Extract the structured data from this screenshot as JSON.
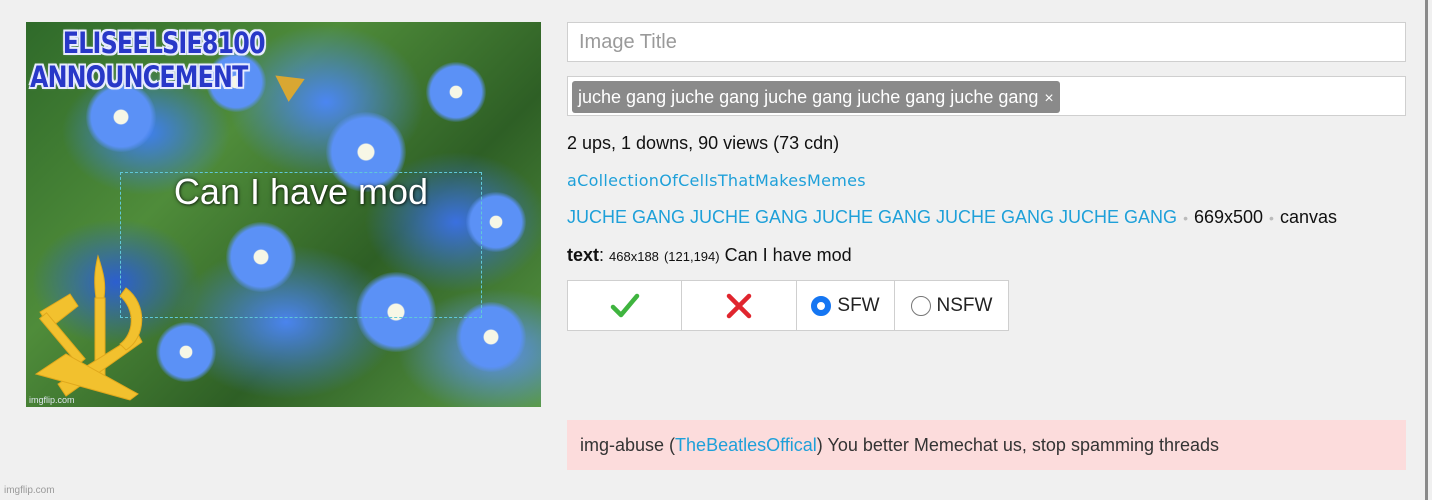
{
  "image": {
    "header_line1": "ELISEELSIE8100",
    "header_line2": "ANNOUNCEMENT",
    "overlay_text": "Can I have mod",
    "watermark": "imgflip.com"
  },
  "form": {
    "title_placeholder": "Image Title",
    "tags": [
      {
        "label": "juche gang juche gang juche gang juche gang juche gang",
        "remove_glyph": "×"
      }
    ]
  },
  "stats": "2 ups, 1 downs, 90 views (73 cdn)",
  "author": "aCollectionOfCellsThatMakesMemes",
  "meta": {
    "tag_link": "JUCHE GANG JUCHE GANG JUCHE GANG JUCHE GANG JUCHE GANG",
    "separator": "•",
    "dimensions": "669x500",
    "type": "canvas"
  },
  "text_box": {
    "label": "text",
    "dims": "468x188",
    "position": "(121,194)",
    "value": "Can I have mod"
  },
  "moderation": {
    "approve_icon": "checkmark-icon",
    "approve_color": "#3fb43f",
    "reject_icon": "x-icon",
    "reject_color": "#e0252e",
    "sfw_label": "SFW",
    "nsfw_label": "NSFW",
    "selected": "SFW",
    "radio_color": "#1576f2"
  },
  "abuse": {
    "prefix": "img-abuse (",
    "user": "TheBeatlesOffical",
    "message": ") You better Memechat us, stop spamming threads",
    "background": "#fcdcdc"
  },
  "site_watermark": "imgflip.com"
}
